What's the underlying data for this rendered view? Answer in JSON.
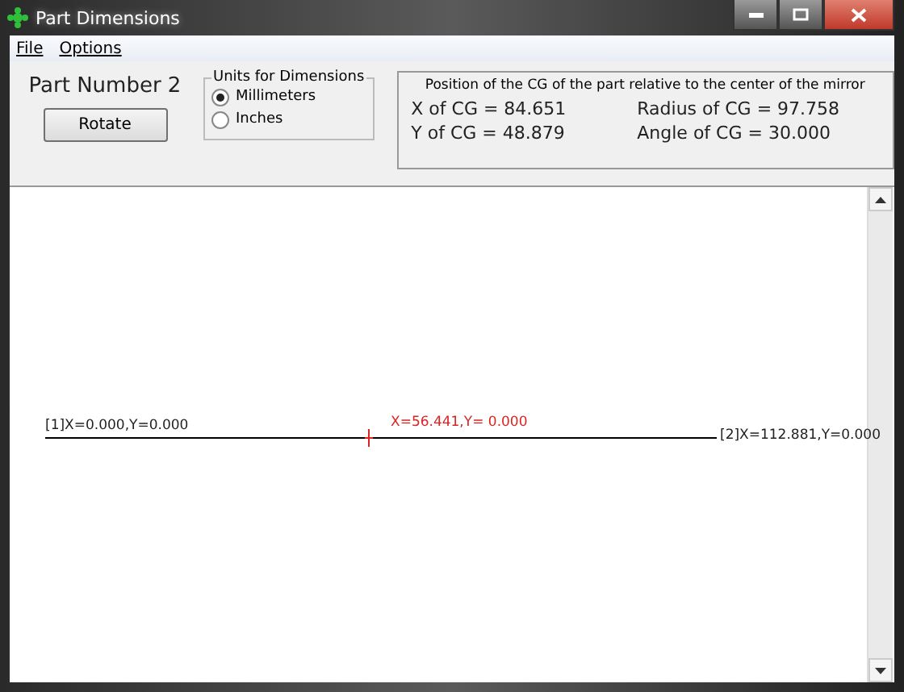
{
  "window": {
    "title": "Part Dimensions"
  },
  "menu": [
    {
      "label": "File"
    },
    {
      "label": "Options"
    }
  ],
  "part": {
    "label": "Part Number 2",
    "button": "Rotate"
  },
  "units": {
    "title": "Units for Dimensions",
    "options": [
      {
        "label": "Millimeters",
        "selected": true
      },
      {
        "label": "Inches",
        "selected": false
      }
    ]
  },
  "cg": {
    "title": "Position of the CG of the part relative to the center of the mirror",
    "values": [
      "X of CG = 84.651",
      "Radius of CG = 97.758",
      "Y of CG = 48.879",
      "Angle of CG = 30.000"
    ]
  },
  "canvas": {
    "start_label": "[1]X=0.000,Y=0.000",
    "mid_label": "X=56.441,Y= 0.000",
    "end_label": "[2]X=112.881,Y=0.000"
  }
}
